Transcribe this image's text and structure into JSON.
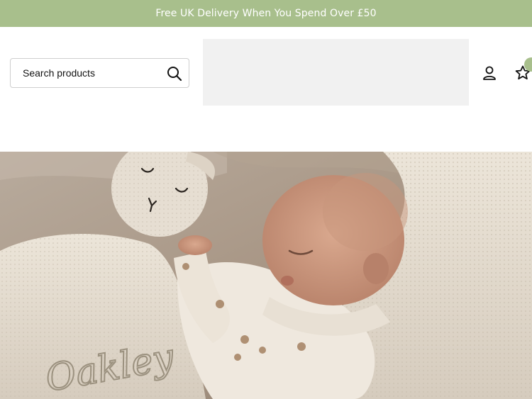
{
  "announcement": {
    "text": "Free UK Delivery When You Spend Over £50"
  },
  "search": {
    "placeholder": "Search products"
  },
  "header": {
    "wishlist_count": ""
  },
  "hero": {
    "embroidered_name": "Oakley"
  },
  "colors": {
    "accent": "#a8bf8c",
    "logo_placeholder": "#f1f1f1"
  },
  "icons": {
    "search": "search-icon",
    "account": "user-icon",
    "wishlist": "star-icon"
  }
}
